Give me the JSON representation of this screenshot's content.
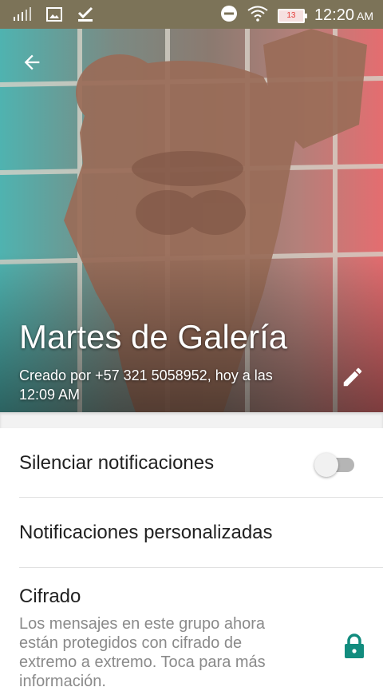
{
  "status_bar": {
    "time": "12:20",
    "ampm": "AM",
    "battery_level": "13",
    "icons": [
      "signal-icon",
      "image-notification-icon",
      "download-done-icon",
      "do-not-disturb-icon",
      "wifi-icon",
      "battery-icon"
    ]
  },
  "header": {
    "title": "Martes de Galería",
    "subtitle": "Creado por +57 321 5058952, hoy a las 12:09 AM",
    "back_icon": "arrow-back-icon",
    "edit_icon": "pencil-icon"
  },
  "settings": {
    "mute": {
      "label": "Silenciar notificaciones",
      "enabled": false
    },
    "custom": {
      "label": "Notificaciones personalizadas"
    },
    "encryption": {
      "title": "Cifrado",
      "description": "Los mensajes en este grupo ahora están protegidos con cifrado de extremo a extremo. Toca para más información.",
      "icon": "lock-icon",
      "icon_color": "#128c7e"
    }
  },
  "colors": {
    "status_bar": "#7c7358",
    "accent": "#128c7e"
  }
}
